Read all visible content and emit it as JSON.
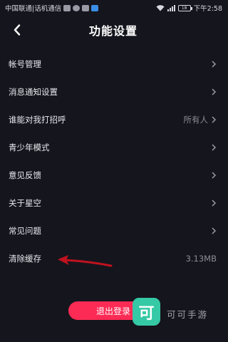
{
  "status_bar": {
    "carrier": "中国联通|话机通信",
    "battery": "18",
    "time": "下午2:58"
  },
  "header": {
    "title": "功能设置"
  },
  "settings": [
    {
      "label": "帐号管理",
      "value": ""
    },
    {
      "label": "消息通知设置",
      "value": ""
    },
    {
      "label": "谁能对我打招呼",
      "value": "所有人"
    },
    {
      "label": "青少年模式",
      "value": ""
    },
    {
      "label": "意见反馈",
      "value": ""
    },
    {
      "label": "关于星空",
      "value": ""
    },
    {
      "label": "常见问题",
      "value": ""
    },
    {
      "label": "清除缓存",
      "value": "3.13MB"
    }
  ],
  "logout_label": "退出登录",
  "watermark": {
    "badge": "可",
    "text": "可可手游"
  },
  "colors": {
    "background": "#15151d",
    "accent": "#fc2b55",
    "annotation_arrow": "#c0121f",
    "watermark": "#35c9a6"
  }
}
